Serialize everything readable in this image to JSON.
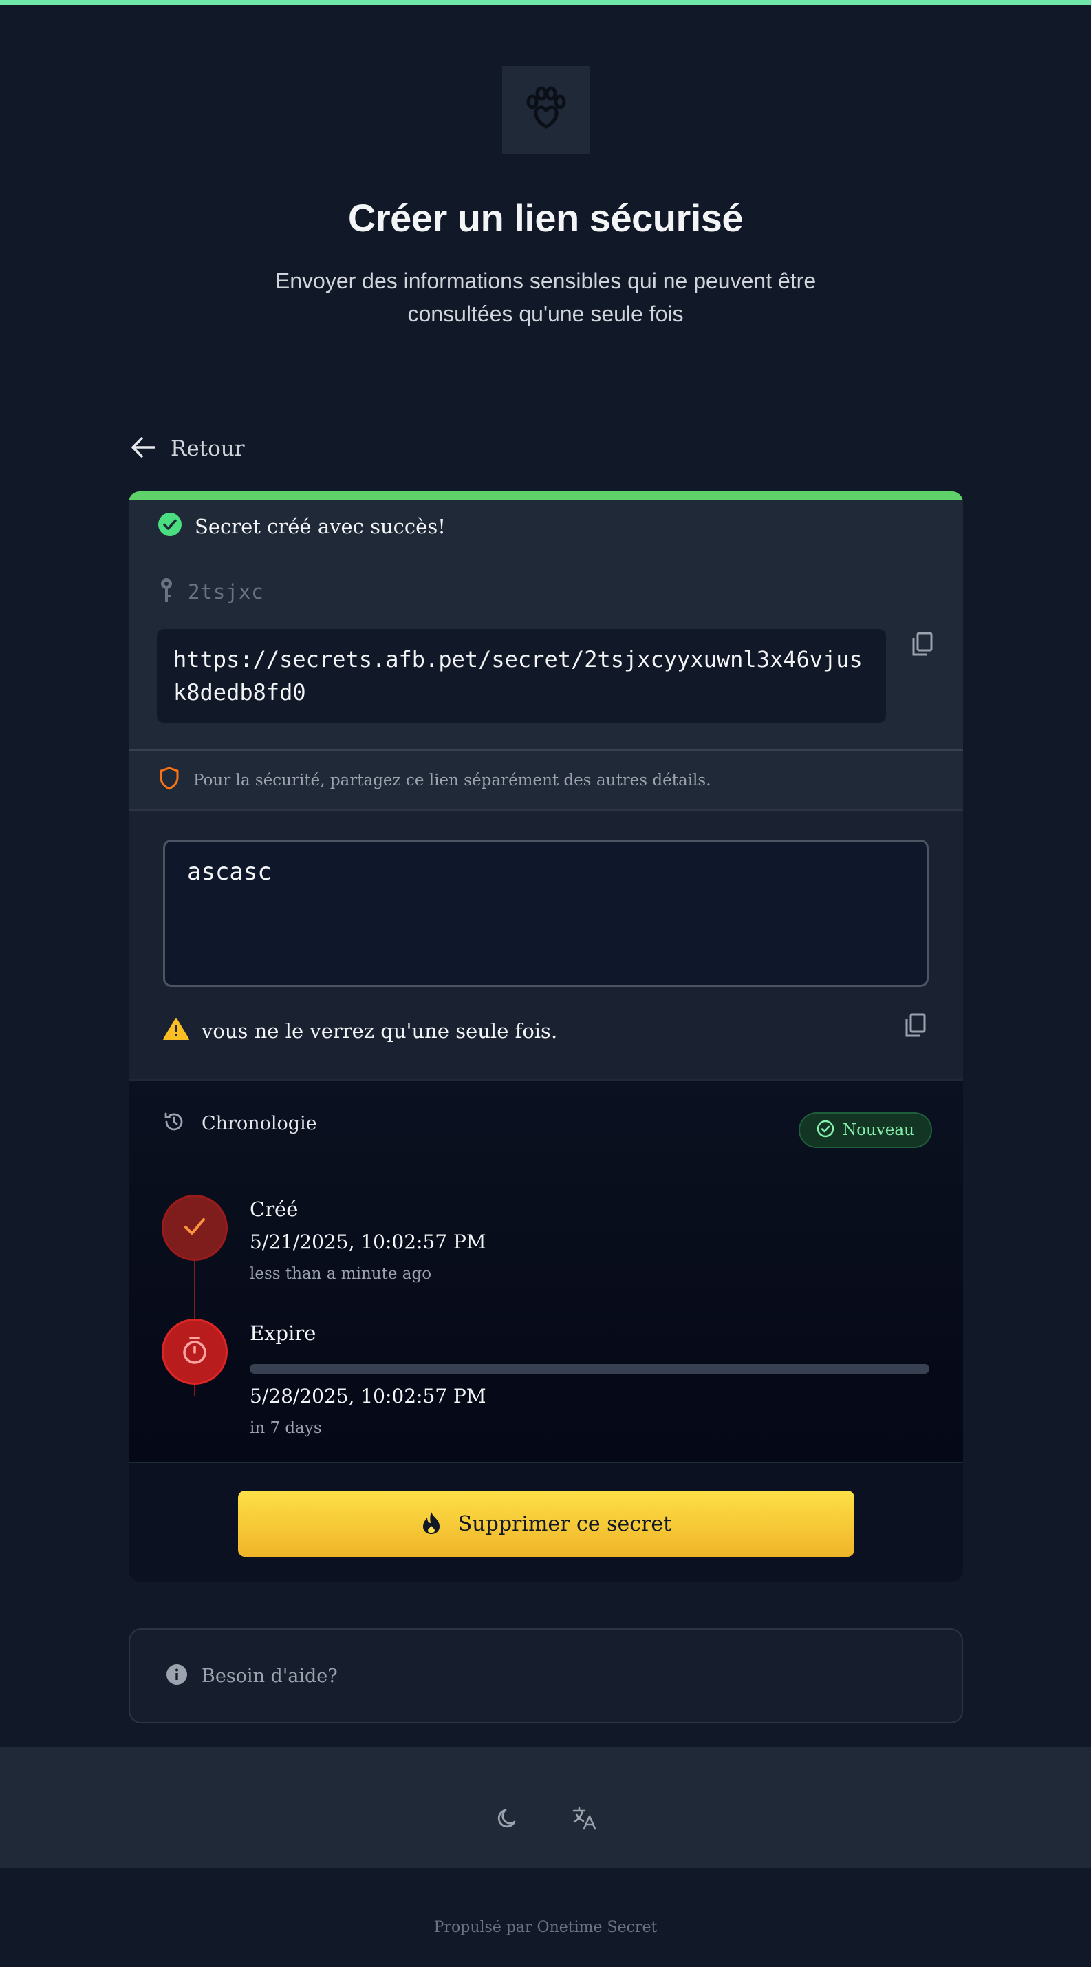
{
  "colors": {
    "accent_green": "#6ee7a9",
    "success": "#5fd36a",
    "warning": "#fbbf24",
    "danger": "#b91c1c",
    "background": "#111827"
  },
  "header": {
    "logo_icon": "paw-heart-icon",
    "title": "Créer un lien sécurisé",
    "subtitle": "Envoyer des informations sensibles qui ne peuvent être consultées qu'une seule fois"
  },
  "nav": {
    "back_label": "Retour"
  },
  "secret_link": {
    "success_message": "Secret créé avec succès!",
    "secret_id": "2tsjxc",
    "url": "https://secrets.afb.pet/secret/2tsjxcyyxuwnl3x46vjusk8dedb8fd0",
    "security_note": "Pour la sécurité, partagez ce lien séparément des autres détails."
  },
  "secret_content": {
    "value": "ascasc",
    "warning": "vous ne le verrez qu'une seule fois."
  },
  "timeline": {
    "title": "Chronologie",
    "badge": "Nouveau",
    "created": {
      "label": "Créé",
      "date": "5/21/2025, 10:02:57 PM",
      "relative": "less than a minute ago"
    },
    "expire": {
      "label": "Expire",
      "date": "5/28/2025, 10:02:57 PM",
      "relative": "in 7 days",
      "progress_fraction": 0.0
    }
  },
  "actions": {
    "delete_label": "Supprimer ce secret"
  },
  "help": {
    "label": "Besoin d'aide?"
  },
  "footer": {
    "powered_by": "Propulsé par Onetime Secret"
  }
}
